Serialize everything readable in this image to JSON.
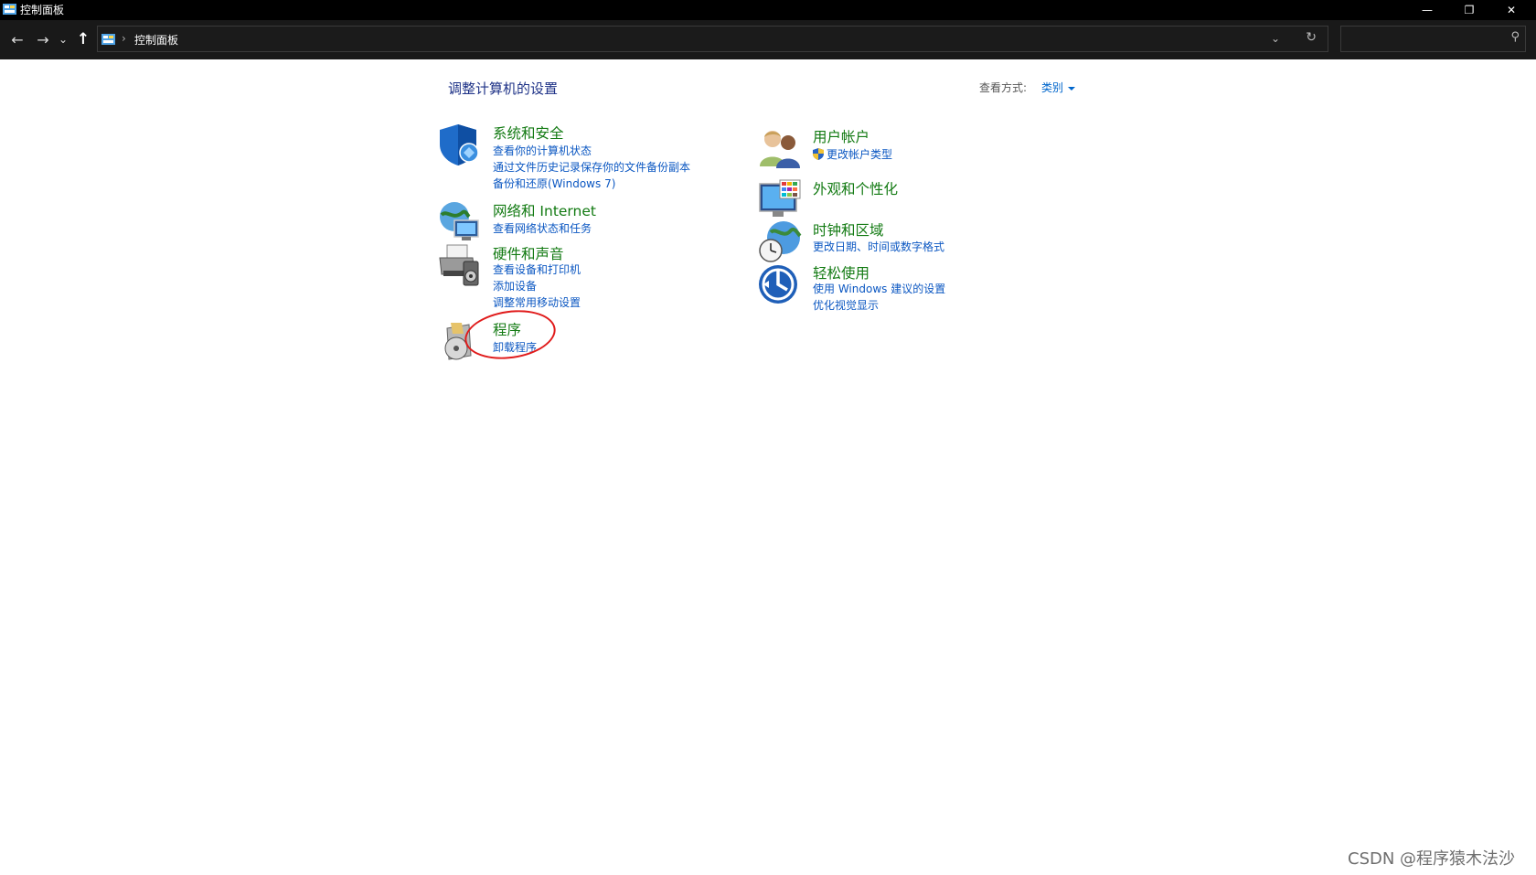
{
  "window": {
    "title": "控制面板",
    "minimize": "—",
    "restore": "❐",
    "close": "✕"
  },
  "nav": {
    "back": "←",
    "forward": "→",
    "recent": "⌄",
    "up": "↑",
    "breadcrumb_sep": "›",
    "breadcrumb": "控制面板",
    "address_dropdown": "⌄",
    "refresh": "↻",
    "search_placeholder": "",
    "search_icon": "⚲"
  },
  "content": {
    "heading": "调整计算机的设置",
    "view_by_label": "查看方式:",
    "view_by_value": "类别"
  },
  "categories": {
    "system_security": {
      "icon": "shield-icon",
      "title": "系统和安全",
      "links": [
        "查看你的计算机状态",
        "通过文件历史记录保存你的文件备份副本",
        "备份和还原(Windows 7)"
      ]
    },
    "network": {
      "icon": "globe-network-icon",
      "title": "网络和 Internet",
      "links": [
        "查看网络状态和任务"
      ]
    },
    "hardware": {
      "icon": "printer-speaker-icon",
      "title": "硬件和声音",
      "links": [
        "查看设备和打印机",
        "添加设备",
        "调整常用移动设置"
      ]
    },
    "programs": {
      "icon": "programs-disc-icon",
      "title": "程序",
      "links": [
        "卸载程序"
      ]
    },
    "user_accounts": {
      "icon": "users-icon",
      "title": "用户帐户",
      "links": [
        "更改帐户类型"
      ]
    },
    "appearance": {
      "icon": "monitor-palette-icon",
      "title": "外观和个性化",
      "links": []
    },
    "clock_region": {
      "icon": "clock-globe-icon",
      "title": "时钟和区域",
      "links": [
        "更改日期、时间或数字格式"
      ]
    },
    "ease_of_access": {
      "icon": "ease-of-access-icon",
      "title": "轻松使用",
      "links": [
        "使用 Windows 建议的设置",
        "优化视觉显示"
      ]
    }
  },
  "watermark": "CSDN @程序猿木法沙",
  "colors": {
    "category_title": "#127a12",
    "link": "#0b57c2",
    "heading": "#1e3287",
    "annotation": "#e01b1b",
    "titlebar": "#000000",
    "navbar": "#191919"
  }
}
